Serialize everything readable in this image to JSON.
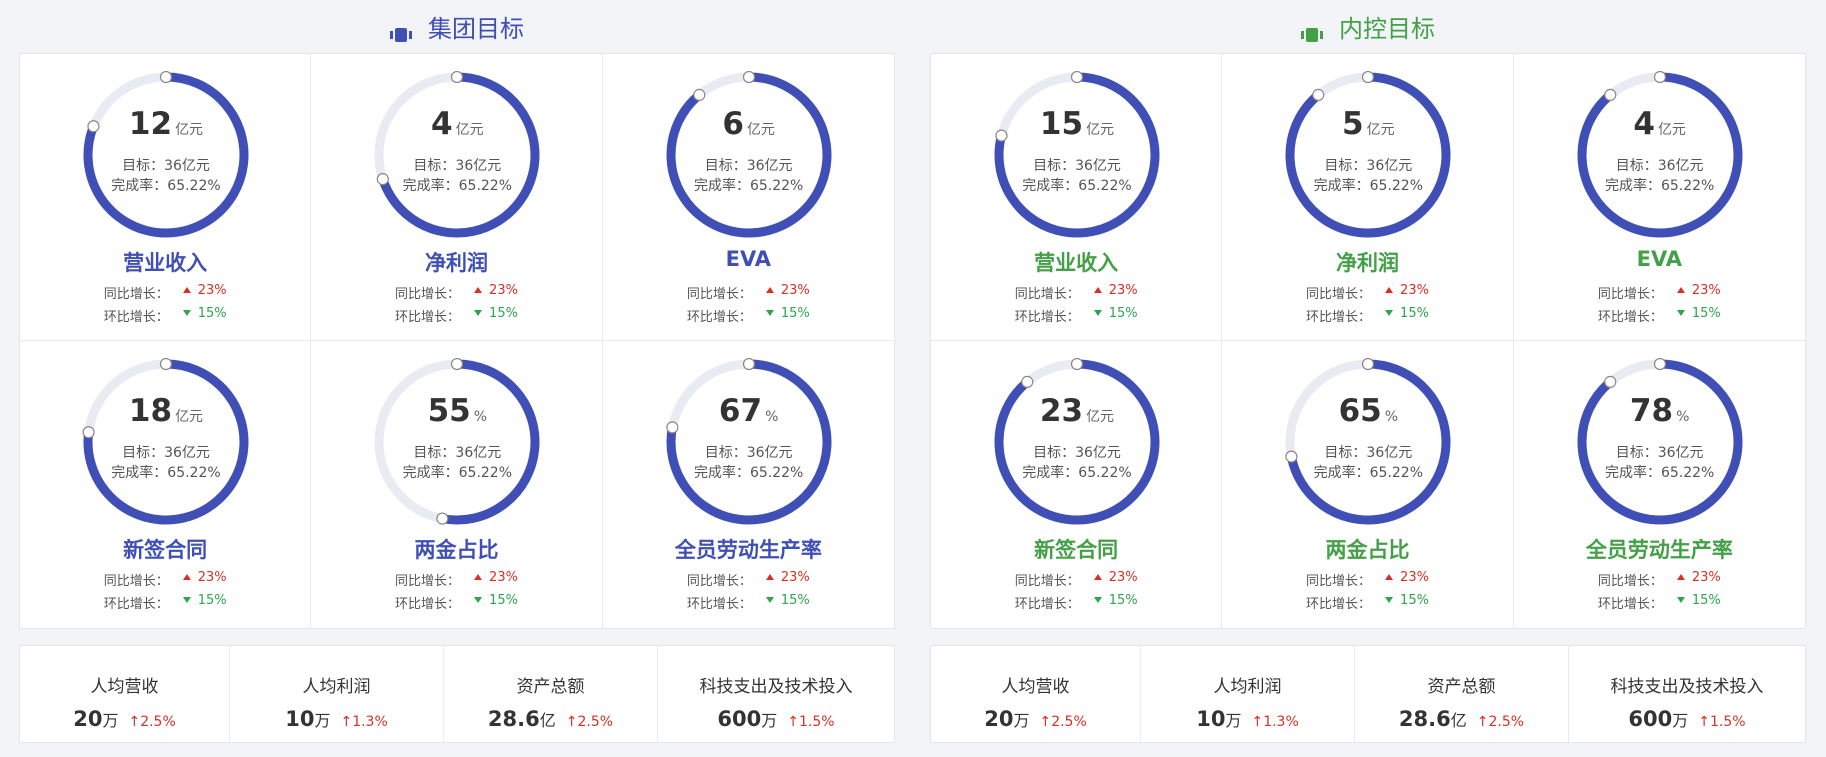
{
  "colors": {
    "ring": "#3f4fb5",
    "ring_track": "#e9ebf3",
    "left_accent": "#3f4fb5",
    "right_accent": "#43a047",
    "up": "#d93025",
    "down": "#2ea44f"
  },
  "panels": [
    {
      "title": "集团目标",
      "icon": "film-icon",
      "metrics": [
        {
          "value": "12",
          "unit": "亿元",
          "target": "目标：36亿元",
          "rate": "完成率：65.22%",
          "name": "营业收入",
          "yoy_label": "同比增长：",
          "yoy": "23%",
          "mom_label": "环比增长：",
          "mom": "15%",
          "progress": 0.81
        },
        {
          "value": "4",
          "unit": "亿元",
          "target": "目标：36亿元",
          "rate": "完成率：65.22%",
          "name": "净利润",
          "yoy_label": "同比增长：",
          "yoy": "23%",
          "mom_label": "环比增长：",
          "mom": "15%",
          "progress": 0.7
        },
        {
          "value": "6",
          "unit": "亿元",
          "target": "目标：36亿元",
          "rate": "完成率：65.22%",
          "name": "EVA",
          "yoy_label": "同比增长：",
          "yoy": "23%",
          "mom_label": "环比增长：",
          "mom": "15%",
          "progress": 0.89
        },
        {
          "value": "18",
          "unit": "亿元",
          "target": "目标：36亿元",
          "rate": "完成率：65.22%",
          "name": "新签合同",
          "yoy_label": "同比增长：",
          "yoy": "23%",
          "mom_label": "环比增长：",
          "mom": "15%",
          "progress": 0.77
        },
        {
          "value": "55",
          "unit": "%",
          "target": "目标：36亿元",
          "rate": "完成率：65.22%",
          "name": "两金占比",
          "yoy_label": "同比增长：",
          "yoy": "23%",
          "mom_label": "环比增长：",
          "mom": "15%",
          "progress": 0.53
        },
        {
          "value": "67",
          "unit": "%",
          "target": "目标：36亿元",
          "rate": "完成率：65.22%",
          "name": "全员劳动生产率",
          "yoy_label": "同比增长：",
          "yoy": "23%",
          "mom_label": "环比增长：",
          "mom": "15%",
          "progress": 0.78
        }
      ],
      "stats": [
        {
          "label": "人均营收",
          "value": "20",
          "unit": "万",
          "change": "↑2.5%"
        },
        {
          "label": "人均利润",
          "value": "10",
          "unit": "万",
          "change": "↑1.3%"
        },
        {
          "label": "资产总额",
          "value": "28.6",
          "unit": "亿",
          "change": "↑2.5%"
        },
        {
          "label": "科技支出及技术投入",
          "value": "600",
          "unit": "万",
          "change": "↑1.5%"
        }
      ]
    },
    {
      "title": "内控目标",
      "icon": "film-icon",
      "metrics": [
        {
          "value": "15",
          "unit": "亿元",
          "target": "目标：36亿元",
          "rate": "完成率：65.22%",
          "name": "营业收入",
          "yoy_label": "同比增长：",
          "yoy": "23%",
          "mom_label": "环比增长：",
          "mom": "15%",
          "progress": 0.79
        },
        {
          "value": "5",
          "unit": "亿元",
          "target": "目标：36亿元",
          "rate": "完成率：65.22%",
          "name": "净利润",
          "yoy_label": "同比增长：",
          "yoy": "23%",
          "mom_label": "环比增长：",
          "mom": "15%",
          "progress": 0.89
        },
        {
          "value": "4",
          "unit": "亿元",
          "target": "目标：36亿元",
          "rate": "完成率：65.22%",
          "name": "EVA",
          "yoy_label": "同比增长：",
          "yoy": "23%",
          "mom_label": "环比增长：",
          "mom": "15%",
          "progress": 0.89
        },
        {
          "value": "23",
          "unit": "亿元",
          "target": "目标：36亿元",
          "rate": "完成率：65.22%",
          "name": "新签合同",
          "yoy_label": "同比增长：",
          "yoy": "23%",
          "mom_label": "环比增长：",
          "mom": "15%",
          "progress": 0.89
        },
        {
          "value": "65",
          "unit": "%",
          "target": "目标：36亿元",
          "rate": "完成率：65.22%",
          "name": "两金占比",
          "yoy_label": "同比增长：",
          "yoy": "23%",
          "mom_label": "环比增长：",
          "mom": "15%",
          "progress": 0.72
        },
        {
          "value": "78",
          "unit": "%",
          "target": "目标：36亿元",
          "rate": "完成率：65.22%",
          "name": "全员劳动生产率",
          "yoy_label": "同比增长：",
          "yoy": "23%",
          "mom_label": "环比增长：",
          "mom": "15%",
          "progress": 0.89
        }
      ],
      "stats": [
        {
          "label": "人均营收",
          "value": "20",
          "unit": "万",
          "change": "↑2.5%"
        },
        {
          "label": "人均利润",
          "value": "10",
          "unit": "万",
          "change": "↑1.3%"
        },
        {
          "label": "资产总额",
          "value": "28.6",
          "unit": "亿",
          "change": "↑2.5%"
        },
        {
          "label": "科技支出及技术投入",
          "value": "600",
          "unit": "万",
          "change": "↑1.5%"
        }
      ]
    }
  ]
}
